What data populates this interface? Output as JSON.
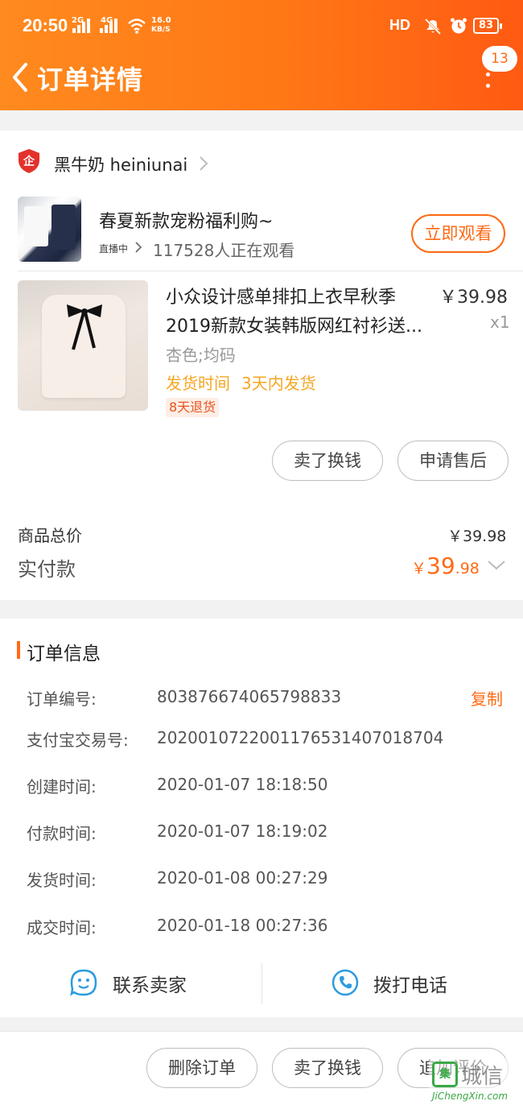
{
  "status_bar": {
    "time": "20:50",
    "sig1": "2G",
    "sig2": "4G",
    "net_speed": "16.0",
    "net_unit": "KB/S",
    "hd": "HD",
    "battery": "83"
  },
  "nav": {
    "title": "订单详情",
    "badge": "13",
    "accent": "#ff7716"
  },
  "shop": {
    "name": "黑牛奶 heiniunai",
    "badge_char": "企"
  },
  "live": {
    "title": "春夏新款宠粉福利购~",
    "status": "直播中",
    "viewers": "117528人正在观看",
    "watch_label": "立即观看"
  },
  "product": {
    "title_line1": "小众设计感单排扣上衣早秋季",
    "title_line2": "2019新款女装韩版网红衬衫送...",
    "price": "￥39.98",
    "qty": "x1",
    "sku": "杏色;均码",
    "ship_label": "发货时间",
    "ship_value": "3天内发货",
    "return_tag": "8天退货",
    "btn_resell": "卖了换钱",
    "btn_aftersale": "申请售后"
  },
  "totals": {
    "goods_label": "商品总价",
    "goods_value": "￥39.98",
    "paid_label": "实付款",
    "paid_currency": "￥",
    "paid_int": "39",
    "paid_dec": ".98"
  },
  "order_info": {
    "section_title": "订单信息",
    "copy_label": "复制",
    "rows": [
      {
        "label": "订单编号:",
        "value": "803876674065798833"
      },
      {
        "label": "支付宝交易号:",
        "value": "2020010722001176531407018704"
      },
      {
        "label": "创建时间:",
        "value": "2020-01-07 18:18:50"
      },
      {
        "label": "付款时间:",
        "value": "2020-01-07 18:19:02"
      },
      {
        "label": "发货时间:",
        "value": "2020-01-08 00:27:29"
      },
      {
        "label": "成交时间:",
        "value": "2020-01-18 00:27:36"
      }
    ],
    "contact_seller": "联系卖家",
    "call_phone": "拨打电话"
  },
  "bottom_bar": {
    "delete_order": "删除订单",
    "resell": "卖了换钱",
    "add_review": "追加评价"
  },
  "watermark": {
    "cn": "城信",
    "en": "JiChengXin.com"
  }
}
